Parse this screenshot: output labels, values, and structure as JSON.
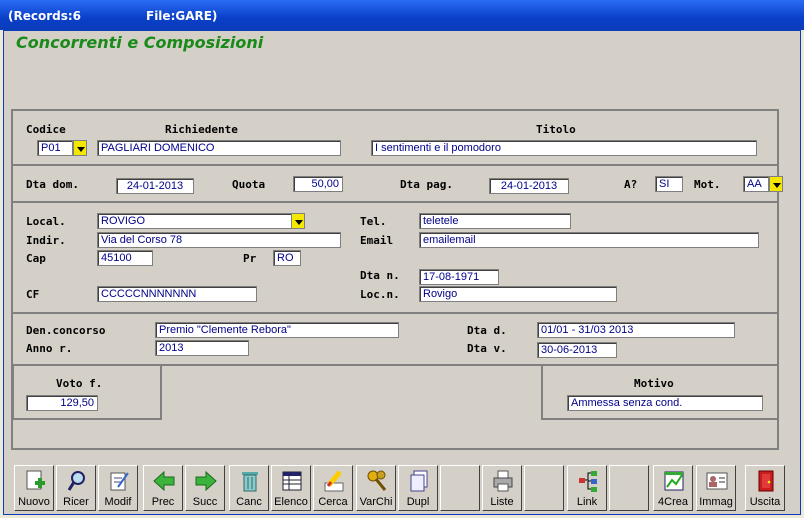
{
  "titlebar": {
    "records": "(Records:6",
    "file": "File:GARE)"
  },
  "app_title": "Concorrenti e Composizioni",
  "section1": {
    "codice_label": "Codice",
    "codice_value": "P01",
    "richiedente_label": "Richiedente",
    "richiedente_value": "PAGLIARI DOMENICO",
    "titolo_label": "Titolo",
    "titolo_value": "I sentimenti e il pomodoro",
    "dtadom_label": "Dta dom.",
    "dtadom_value": "24-01-2013",
    "quota_label": "Quota",
    "quota_value": "50,00",
    "dtapag_label": "Dta pag.",
    "dtapag_value": "24-01-2013",
    "a_label": "A?",
    "a_value": "SI",
    "mot_label": "Mot.",
    "mot_value": "AA"
  },
  "section2": {
    "local_label": "Local.",
    "local_value": "ROVIGO",
    "indir_label": "Indir.",
    "indir_value": "Via del Corso 78",
    "cap_label": "Cap",
    "cap_value": "45100",
    "pr_label": "Pr",
    "pr_value": "RO",
    "cf_label": "CF",
    "cf_value": "CCCCCNNNNNNN",
    "tel_label": "Tel.",
    "tel_value": "teletele",
    "email_label": "Email",
    "email_value": "emailemail",
    "dtan_label": "Dta n.",
    "dtan_value": "17-08-1971",
    "locn_label": "Loc.n.",
    "locn_value": "Rovigo"
  },
  "section3": {
    "den_label": "Den.concorso",
    "den_value": "Premio \"Clemente Rebora\"",
    "anno_label": "Anno r.",
    "anno_value": "2013",
    "dtad_label": "Dta d.",
    "dtad_value": "01/01 - 31/03 2013",
    "dtav_label": "Dta v.",
    "dtav_value": "30-06-2013"
  },
  "voto": {
    "label": "Voto f.",
    "value": "129,50"
  },
  "motivo": {
    "label": "Motivo",
    "value": "Ammessa senza cond."
  },
  "toolbar": {
    "nuovo": "Nuovo",
    "ricer": "Ricer",
    "modif": "Modif",
    "prec": "Prec",
    "succ": "Succ",
    "canc": "Canc",
    "elenco": "Elenco",
    "cerca": "Cerca",
    "varchi": "VarChi",
    "dupl": "Dupl",
    "liste": "Liste",
    "link": "Link",
    "crea4": "4Crea",
    "immag": "Immag",
    "uscita": "Uscita"
  }
}
